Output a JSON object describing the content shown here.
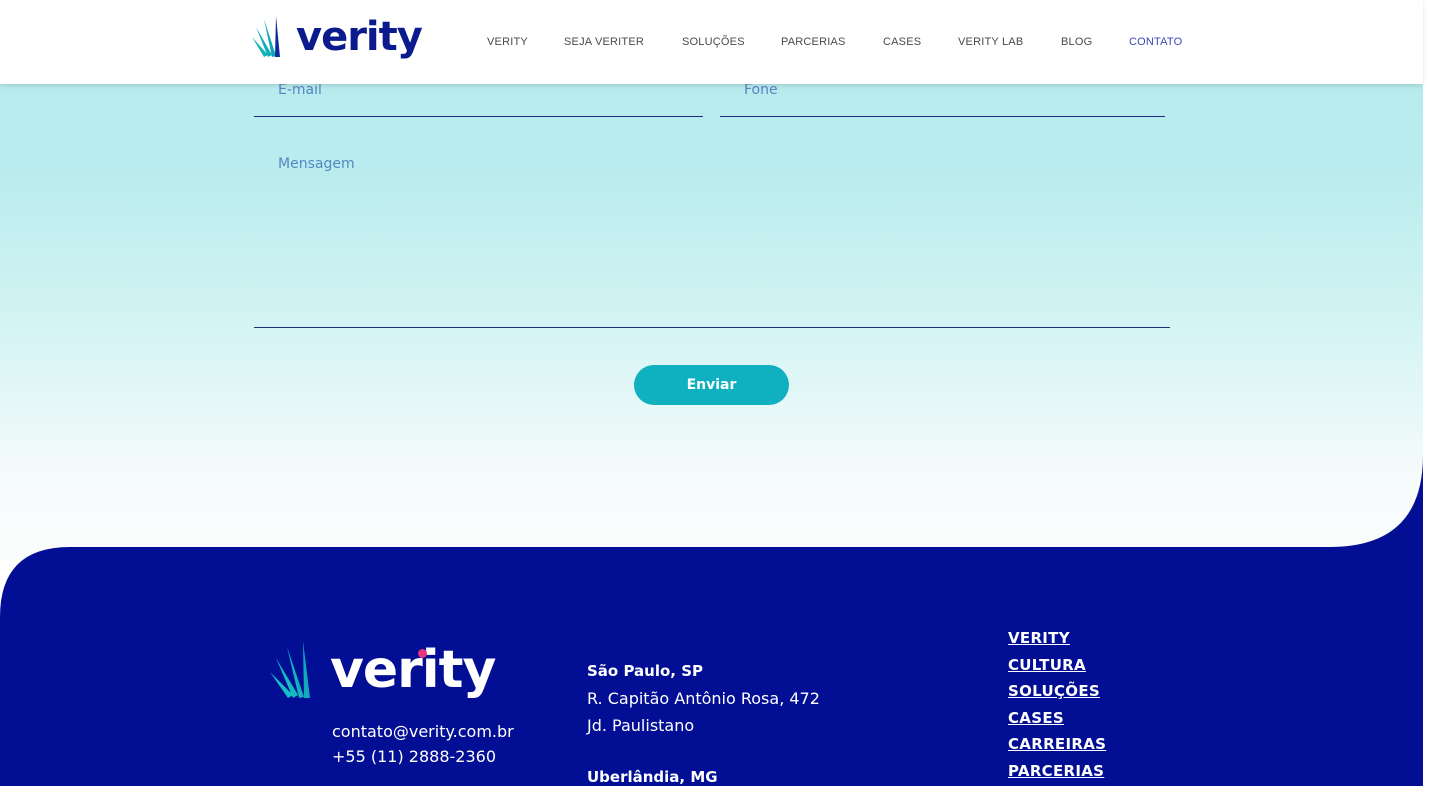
{
  "brand": {
    "name": "verity"
  },
  "colors": {
    "navy": "#020e94",
    "teal": "#0fb0c0",
    "accent_pink": "#e8357f",
    "nav_active": "#3b49b8"
  },
  "nav": {
    "items": [
      {
        "label": "VERITY"
      },
      {
        "label": "SEJA VERITER"
      },
      {
        "label": "SOLUÇÕES"
      },
      {
        "label": "PARCERIAS"
      },
      {
        "label": "CASES"
      },
      {
        "label": "VERITY LAB"
      },
      {
        "label": "BLOG"
      },
      {
        "label": "CONTATO",
        "active": true
      }
    ]
  },
  "form": {
    "email_placeholder": "E-mail",
    "phone_placeholder": "Fone",
    "message_placeholder": "Mensagem",
    "submit_label": "Enviar"
  },
  "footer": {
    "email": "contato@verity.com.br",
    "phone": "+55 (11) 2888-2360",
    "offices": [
      {
        "city": "São Paulo, SP",
        "line1": "R. Capitão Antônio Rosa, 472",
        "line2": "Jd. Paulistano"
      },
      {
        "city": "Uberlândia, MG"
      }
    ],
    "links": [
      "VERITY",
      "CULTURA",
      "SOLUÇÕES",
      "CASES",
      "CARREIRAS",
      "PARCERIAS"
    ]
  }
}
